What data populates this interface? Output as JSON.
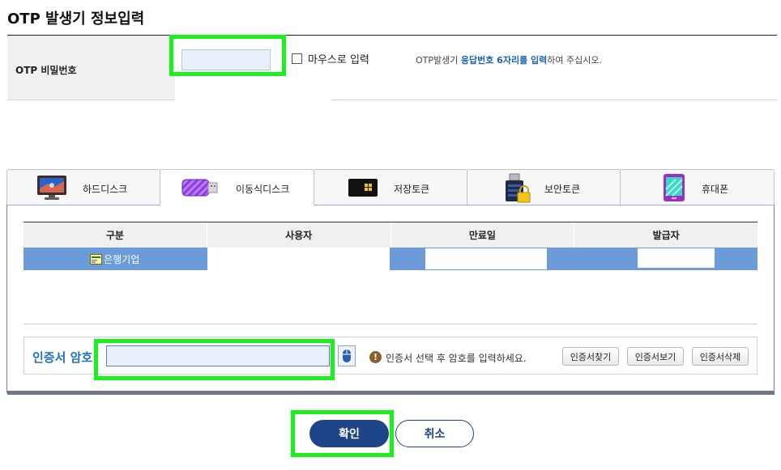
{
  "title": "OTP 발생기 정보입력",
  "otp": {
    "label": "OTP 비밀번호",
    "input_value": "",
    "mouse_input_label": "마우스로 입력",
    "help_prefix": "OTP발생기 ",
    "help_bold": "응답번호 6자리를 입력",
    "help_suffix": "하여 주십시오."
  },
  "tabs": [
    {
      "label": "하드디스크",
      "icon": "monitor-icon",
      "active": false
    },
    {
      "label": "이동식디스크",
      "icon": "usb-drive-icon",
      "active": true
    },
    {
      "label": "저장토큰",
      "icon": "token-chip-icon",
      "active": false
    },
    {
      "label": "보안토큰",
      "icon": "secure-token-lock-icon",
      "active": false
    },
    {
      "label": "휴대폰",
      "icon": "mobile-phone-icon",
      "active": false
    }
  ],
  "table": {
    "headers": [
      "구분",
      "사용자",
      "만료일",
      "발급자"
    ],
    "rows": [
      {
        "type": "은행기업",
        "user": "",
        "expiry": "",
        "issuer": ""
      }
    ]
  },
  "password": {
    "label": "인증서 암호",
    "value": "",
    "warning": "인증서 선택 후 암호를 입력하세요.",
    "buttons": [
      "인증서찾기",
      "인증서보기",
      "인증서삭제"
    ]
  },
  "actions": {
    "ok": "확인",
    "cancel": "취소"
  },
  "colors": {
    "highlight": "#19f01e",
    "selected_row": "#6b9bd9",
    "primary": "#1e4587",
    "link": "#1a64b4"
  }
}
